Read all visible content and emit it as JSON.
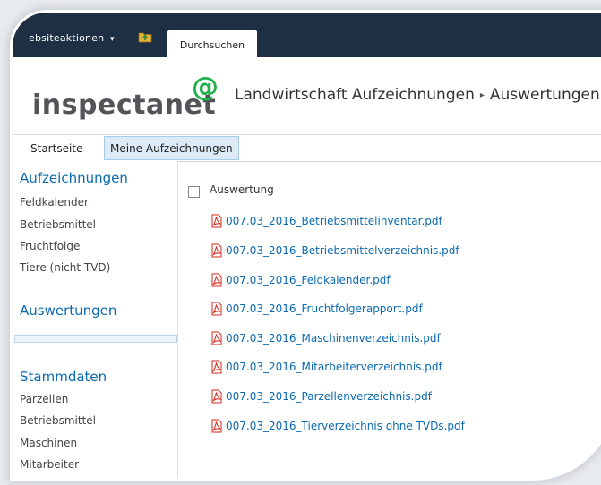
{
  "ribbon": {
    "actions_label": "ebsiteaktionen",
    "actions_caret": "▾",
    "tab_label": "Durchsuchen",
    "folder_icon": "folder-up-icon"
  },
  "brand": {
    "name": "inspectanet",
    "mark": "@"
  },
  "breadcrumb": {
    "site": "Landwirtschaft Aufzeichnungen",
    "separator": "▸",
    "page": "Auswertungen"
  },
  "topnav": {
    "items": [
      "Startseite",
      "Meine Aufzeichnungen"
    ]
  },
  "leftnav": {
    "section1": {
      "heading": "Aufzeichnungen",
      "items": [
        "Feldkalender",
        "Betriebsmittel",
        "Fruchtfolge",
        "Tiere (nicht TVD)"
      ]
    },
    "section2": {
      "heading": "Auswertungen"
    },
    "section3": {
      "heading": "Stammdaten",
      "items": [
        "Parzellen",
        "Betriebsmittel",
        "Maschinen",
        "Mitarbeiter"
      ]
    }
  },
  "list": {
    "select_all_label": "Auswertung",
    "file_icon": "pdf-icon",
    "files": [
      "007.03_2016_Betriebsmittelinventar.pdf",
      "007.03_2016_Betriebsmittelverzeichnis.pdf",
      "007.03_2016_Feldkalender.pdf",
      "007.03_2016_Fruchtfolgerapport.pdf",
      "007.03_2016_Maschinenverzeichnis.pdf",
      "007.03_2016_Mitarbeiterverzeichnis.pdf",
      "007.03_2016_Parzellenverzeichnis.pdf",
      "007.03_2016_Tierverzeichnis ohne TVDs.pdf"
    ]
  },
  "colors": {
    "ribbon_bg": "#1f2f43",
    "link": "#0a6ab0",
    "brand_green": "#20b14b",
    "pdf_red": "#d6281e"
  }
}
